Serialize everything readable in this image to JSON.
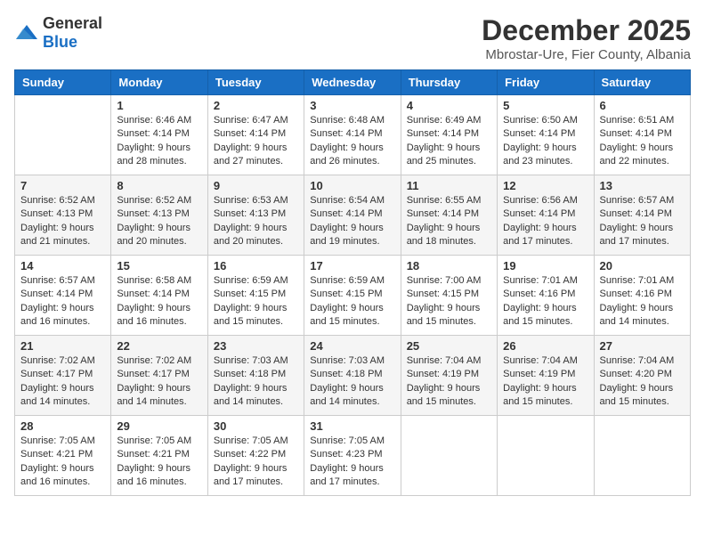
{
  "header": {
    "logo_general": "General",
    "logo_blue": "Blue",
    "month_year": "December 2025",
    "location": "Mbrostar-Ure, Fier County, Albania"
  },
  "days_of_week": [
    "Sunday",
    "Monday",
    "Tuesday",
    "Wednesday",
    "Thursday",
    "Friday",
    "Saturday"
  ],
  "weeks": [
    [
      {
        "day": "",
        "content": ""
      },
      {
        "day": "1",
        "content": "Sunrise: 6:46 AM\nSunset: 4:14 PM\nDaylight: 9 hours\nand 28 minutes."
      },
      {
        "day": "2",
        "content": "Sunrise: 6:47 AM\nSunset: 4:14 PM\nDaylight: 9 hours\nand 27 minutes."
      },
      {
        "day": "3",
        "content": "Sunrise: 6:48 AM\nSunset: 4:14 PM\nDaylight: 9 hours\nand 26 minutes."
      },
      {
        "day": "4",
        "content": "Sunrise: 6:49 AM\nSunset: 4:14 PM\nDaylight: 9 hours\nand 25 minutes."
      },
      {
        "day": "5",
        "content": "Sunrise: 6:50 AM\nSunset: 4:14 PM\nDaylight: 9 hours\nand 23 minutes."
      },
      {
        "day": "6",
        "content": "Sunrise: 6:51 AM\nSunset: 4:14 PM\nDaylight: 9 hours\nand 22 minutes."
      }
    ],
    [
      {
        "day": "7",
        "content": "Sunrise: 6:52 AM\nSunset: 4:13 PM\nDaylight: 9 hours\nand 21 minutes."
      },
      {
        "day": "8",
        "content": "Sunrise: 6:52 AM\nSunset: 4:13 PM\nDaylight: 9 hours\nand 20 minutes."
      },
      {
        "day": "9",
        "content": "Sunrise: 6:53 AM\nSunset: 4:13 PM\nDaylight: 9 hours\nand 20 minutes."
      },
      {
        "day": "10",
        "content": "Sunrise: 6:54 AM\nSunset: 4:14 PM\nDaylight: 9 hours\nand 19 minutes."
      },
      {
        "day": "11",
        "content": "Sunrise: 6:55 AM\nSunset: 4:14 PM\nDaylight: 9 hours\nand 18 minutes."
      },
      {
        "day": "12",
        "content": "Sunrise: 6:56 AM\nSunset: 4:14 PM\nDaylight: 9 hours\nand 17 minutes."
      },
      {
        "day": "13",
        "content": "Sunrise: 6:57 AM\nSunset: 4:14 PM\nDaylight: 9 hours\nand 17 minutes."
      }
    ],
    [
      {
        "day": "14",
        "content": "Sunrise: 6:57 AM\nSunset: 4:14 PM\nDaylight: 9 hours\nand 16 minutes."
      },
      {
        "day": "15",
        "content": "Sunrise: 6:58 AM\nSunset: 4:14 PM\nDaylight: 9 hours\nand 16 minutes."
      },
      {
        "day": "16",
        "content": "Sunrise: 6:59 AM\nSunset: 4:15 PM\nDaylight: 9 hours\nand 15 minutes."
      },
      {
        "day": "17",
        "content": "Sunrise: 6:59 AM\nSunset: 4:15 PM\nDaylight: 9 hours\nand 15 minutes."
      },
      {
        "day": "18",
        "content": "Sunrise: 7:00 AM\nSunset: 4:15 PM\nDaylight: 9 hours\nand 15 minutes."
      },
      {
        "day": "19",
        "content": "Sunrise: 7:01 AM\nSunset: 4:16 PM\nDaylight: 9 hours\nand 15 minutes."
      },
      {
        "day": "20",
        "content": "Sunrise: 7:01 AM\nSunset: 4:16 PM\nDaylight: 9 hours\nand 14 minutes."
      }
    ],
    [
      {
        "day": "21",
        "content": "Sunrise: 7:02 AM\nSunset: 4:17 PM\nDaylight: 9 hours\nand 14 minutes."
      },
      {
        "day": "22",
        "content": "Sunrise: 7:02 AM\nSunset: 4:17 PM\nDaylight: 9 hours\nand 14 minutes."
      },
      {
        "day": "23",
        "content": "Sunrise: 7:03 AM\nSunset: 4:18 PM\nDaylight: 9 hours\nand 14 minutes."
      },
      {
        "day": "24",
        "content": "Sunrise: 7:03 AM\nSunset: 4:18 PM\nDaylight: 9 hours\nand 14 minutes."
      },
      {
        "day": "25",
        "content": "Sunrise: 7:04 AM\nSunset: 4:19 PM\nDaylight: 9 hours\nand 15 minutes."
      },
      {
        "day": "26",
        "content": "Sunrise: 7:04 AM\nSunset: 4:19 PM\nDaylight: 9 hours\nand 15 minutes."
      },
      {
        "day": "27",
        "content": "Sunrise: 7:04 AM\nSunset: 4:20 PM\nDaylight: 9 hours\nand 15 minutes."
      }
    ],
    [
      {
        "day": "28",
        "content": "Sunrise: 7:05 AM\nSunset: 4:21 PM\nDaylight: 9 hours\nand 16 minutes."
      },
      {
        "day": "29",
        "content": "Sunrise: 7:05 AM\nSunset: 4:21 PM\nDaylight: 9 hours\nand 16 minutes."
      },
      {
        "day": "30",
        "content": "Sunrise: 7:05 AM\nSunset: 4:22 PM\nDaylight: 9 hours\nand 17 minutes."
      },
      {
        "day": "31",
        "content": "Sunrise: 7:05 AM\nSunset: 4:23 PM\nDaylight: 9 hours\nand 17 minutes."
      },
      {
        "day": "",
        "content": ""
      },
      {
        "day": "",
        "content": ""
      },
      {
        "day": "",
        "content": ""
      }
    ]
  ]
}
